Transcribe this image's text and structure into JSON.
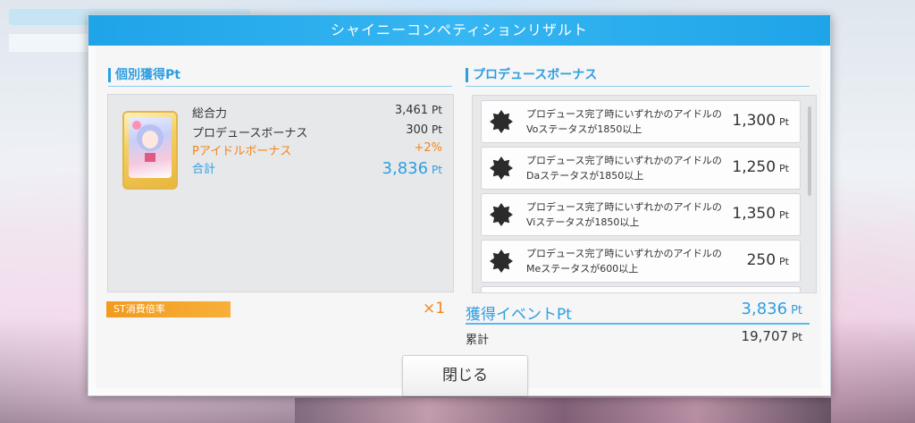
{
  "dialog": {
    "title": "シャイニーコンペティションリザルト",
    "individual_pt": {
      "title": "個別獲得Pt",
      "rows": [
        {
          "label": "総合力",
          "value": "3,461",
          "unit": "Pt"
        },
        {
          "label": "プロデュースボーナス",
          "value": "300",
          "unit": "Pt"
        },
        {
          "label": "Pアイドルボーナス",
          "value": "+2%",
          "unit": ""
        },
        {
          "label": "合計",
          "value": "3,836",
          "unit": "Pt"
        }
      ]
    },
    "produce_bonus": {
      "title": "プロデュースボーナス",
      "items": [
        {
          "line1": "プロデュース完了時にいずれかのアイドルの",
          "line2": "Voステータスが1850以上",
          "pt": "1,300",
          "unit": "Pt"
        },
        {
          "line1": "プロデュース完了時にいずれかのアイドルの",
          "line2": "Daステータスが1850以上",
          "pt": "1,250",
          "unit": "Pt"
        },
        {
          "line1": "プロデュース完了時にいずれかのアイドルの",
          "line2": "Viステータスが1850以上",
          "pt": "1,350",
          "unit": "Pt"
        },
        {
          "line1": "プロデュース完了時にいずれかのアイドルの",
          "line2": "Meステータスが600以上",
          "pt": "250",
          "unit": "Pt"
        }
      ]
    },
    "st_multiplier": {
      "label": "ST消費倍率",
      "value": "×1"
    },
    "event_pt": {
      "label": "獲得イベントPt",
      "value": "3,836",
      "unit": "Pt"
    },
    "cumulative": {
      "label": "累計",
      "value": "19,707",
      "unit": "Pt"
    },
    "close_label": "閉じる"
  },
  "colors": {
    "accent": "#2e9ee0",
    "header": "#1fa4e8",
    "orange": "#f2851c",
    "badge": "#2b2b2b"
  }
}
